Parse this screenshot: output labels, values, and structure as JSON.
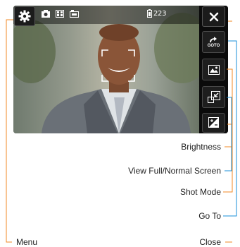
{
  "viewfinder": {
    "battery_value": "223",
    "status_icons": [
      "camera-mode-icon",
      "resolution-icon",
      "storage-icon",
      "battery-icon"
    ]
  },
  "buttons": {
    "menu_icon": "gear-icon",
    "close_icon": "close-icon",
    "goto_icon": "goto-icon",
    "goto_label": "GOTO",
    "shot_mode_icon": "shot-mode-icon",
    "fullscreen_icon": "fullscreen-icon",
    "brightness_icon": "brightness-icon"
  },
  "callouts": {
    "brightness": "Brightness",
    "view_screen": "View Full/Normal Screen",
    "shot_mode": "Shot Mode",
    "go_to": "Go To",
    "menu": "Menu",
    "close": "Close"
  },
  "colors": {
    "callout_orange": "#f08a24",
    "callout_blue": "#1a8fd8"
  }
}
